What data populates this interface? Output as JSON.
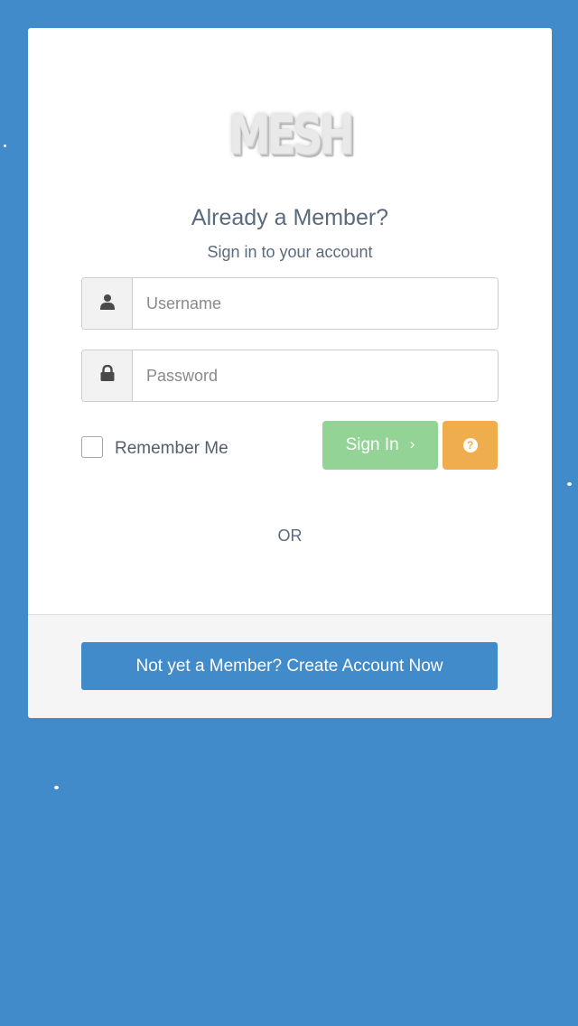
{
  "brand": {
    "logo_text": "MESH"
  },
  "header": {
    "title": "Already a Member?",
    "subtitle": "Sign in to your account"
  },
  "form": {
    "username": {
      "placeholder": "Username",
      "value": "",
      "icon": "user-icon"
    },
    "password": {
      "placeholder": "Password",
      "value": "",
      "icon": "lock-icon"
    },
    "remember_label": "Remember Me",
    "remember_checked": false,
    "signin_label": "Sign In",
    "signin_chevron": "›",
    "help_icon": "question-circle-icon",
    "help_glyph": "?"
  },
  "divider_text": "OR",
  "footer": {
    "create_account_label": "Not yet a Member? Create Account Now"
  },
  "colors": {
    "background": "#428bca",
    "card": "#ffffff",
    "signin_button": "#93d396",
    "help_button": "#f0ad4e",
    "create_button": "#428bca",
    "footer_bg": "#f5f5f5"
  }
}
